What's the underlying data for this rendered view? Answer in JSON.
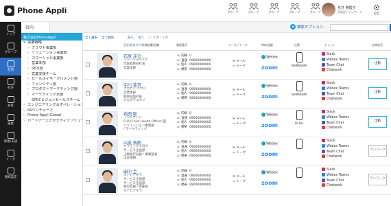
{
  "app": {
    "logo": "Phone Appli"
  },
  "topbar": {
    "groups": [
      "グループ",
      "グループ",
      "グループ",
      "グループ",
      "グループ"
    ],
    "user": {
      "name": "島井 英理子",
      "sub": "営業部 / テレワーク"
    },
    "settings": "設定"
  },
  "sidebar": {
    "items": [
      {
        "label": "トップ"
      },
      {
        "label": "グループ"
      },
      {
        "label": "社内"
      },
      {
        "label": "社外"
      },
      {
        "label": "会社"
      },
      {
        "label": "履歴"
      },
      {
        "label": "新着/未読"
      },
      {
        "label": "トーク"
      },
      {
        "label": "通知設定"
      }
    ],
    "active_index": 2
  },
  "crumb": {
    "label": "社内"
  },
  "search": {
    "options_label": "検索オプション",
    "button": "検索",
    "placeholder": ""
  },
  "tree": {
    "root": "株式会社PhoneAppli",
    "items": [
      {
        "arrow": "▾",
        "label": "事業戦略",
        "indent": 0
      },
      {
        "arrow": "›",
        "label": "クラウド事業部",
        "indent": 1
      },
      {
        "arrow": "›",
        "label": "ソリューション事業部",
        "indent": 1
      },
      {
        "arrow": "›",
        "label": "コマーシャル事業部",
        "indent": 1
      },
      {
        "arrow": "›",
        "label": "営業本部",
        "indent": 1
      },
      {
        "arrow": "›",
        "label": "SE本部",
        "indent": 1
      },
      {
        "arrow": "›",
        "label": "営業支援チーム",
        "indent": 1
      },
      {
        "arrow": "›",
        "label": "セールスイネーブルメント部",
        "indent": 1
      },
      {
        "arrow": "›",
        "label": "ファンシティ部",
        "indent": 1
      },
      {
        "arrow": "›",
        "label": "プロダクトマーケティング部",
        "indent": 1
      },
      {
        "arrow": "›",
        "label": "マーケティング本部",
        "indent": 1
      },
      {
        "arrow": "",
        "label": "SPDCビジョンセールスチーム",
        "indent": 1
      },
      {
        "arrow": "›",
        "label": "エンジニアリング＆オペレーション戦略",
        "indent": 0
      },
      {
        "arrow": "›",
        "label": "PAベンチャーズ",
        "indent": 0
      },
      {
        "arrow": "›",
        "label": "Phone Appli Global",
        "indent": 0
      },
      {
        "arrow": "›",
        "label": "パートナーエグゼクティブソリューション",
        "indent": 0
      }
    ]
  },
  "toolbar": {
    "select_all": "全て選択",
    "clear_all": "全て解除",
    "prev": "前へ",
    "next": "次へ",
    "page": "1 - 5 件 / 5 件"
  },
  "columns": {
    "name": "氏名/氏名カナ/所属部署/役職",
    "phone": "電話番号",
    "mail": "メール / トーク",
    "web": "Web会議",
    "loc": "位置",
    "chat": "チャット",
    "status": "在席状況"
  },
  "common": {
    "phone_labels": [
      "内線",
      "直通",
      "個人",
      "携帯"
    ],
    "mail": "メール",
    "talk": "トーク",
    "webex": "Webex",
    "zoom": "zoom",
    "chats": [
      "Slack",
      "Webex Teams",
      "Team Chat",
      "Chatwork"
    ],
    "chat_colors": [
      "#e01e5a",
      "#1d86e8",
      "#4b53bc",
      "#e53935"
    ]
  },
  "rows": [
    {
      "name": "石原 洋介",
      "kana": [
        "イシハラヨウスケ",
        "代表取締役社長",
        "営業本部"
      ],
      "phones": [
        "0",
        "09000000000",
        "09000000000",
        "09000000000"
      ],
      "location": "SHIRAKAMI",
      "status": "出勤",
      "status_kind": "office"
    },
    {
      "name": "中川 祐司",
      "kana": [
        "ナカガワ ユウジ",
        "営業本部",
        "取締役副社長",
        "ナカガワユウジ"
      ],
      "phones": [
        "0",
        "09000000000",
        "09000000000",
        "09000000000"
      ],
      "location": "SHIRAKAMI",
      "status": "出勤",
      "status_kind": "office"
    },
    {
      "name": "岩田 聡",
      "kana": [
        "イワタサトシ",
        "CHO(Chief Health Officer)室",
        "ソリューション事業部",
        "/ マーケティング"
      ],
      "phones": [
        "0",
        "09000000000",
        "09000000000",
        "09000000000"
      ],
      "location": "FA Bar",
      "status": "出勤",
      "status_kind": "office"
    },
    {
      "name": "山本 拓朗",
      "kana": [
        "ヤマモトタクロウ",
        "サービス企画部",
        "上級執行役員 / 事業部長",
        "山本拓朗"
      ],
      "phones": [
        "0",
        "09000000000",
        "09000000000",
        "09000000000"
      ],
      "location": "",
      "status": "テレワーク",
      "status_kind": "remote"
    },
    {
      "name": "田中 圭",
      "kana": [
        "タナカアキラ",
        "サービス企画部",
        "サービス企画部",
        "執行役員 / 本部長",
        "タナカアキラ"
      ],
      "phones": [
        "0",
        "09000000000",
        "09000000000",
        "09000000000"
      ],
      "location": "",
      "status": "テレワーク",
      "status_kind": "remote"
    }
  ]
}
